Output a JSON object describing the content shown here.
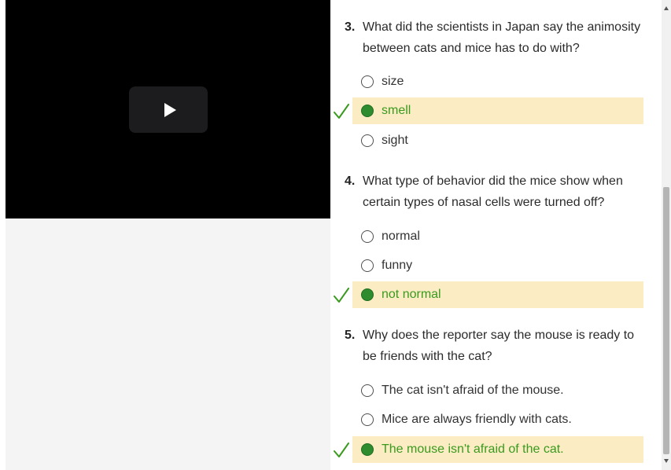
{
  "colors": {
    "accent_correct": "#3a9a1e",
    "correct_highlight": "#fbecc4",
    "radio_fill": "#2e8b2e",
    "video_bg": "#000000"
  },
  "video": {
    "play_icon": "play-icon"
  },
  "questions": [
    {
      "number": "3.",
      "text": "What did the scientists in Japan say the animosity between cats and mice has to do with?",
      "options": [
        {
          "label": "size",
          "selected": false,
          "correct": false
        },
        {
          "label": "smell",
          "selected": true,
          "correct": true
        },
        {
          "label": "sight",
          "selected": false,
          "correct": false
        }
      ]
    },
    {
      "number": "4.",
      "text": "What type of behavior did the mice show when certain types of nasal cells were turned off?",
      "options": [
        {
          "label": "normal",
          "selected": false,
          "correct": false
        },
        {
          "label": "funny",
          "selected": false,
          "correct": false
        },
        {
          "label": "not normal",
          "selected": true,
          "correct": true
        }
      ]
    },
    {
      "number": "5.",
      "text": "Why does the reporter say the mouse is ready to be friends with the cat?",
      "options": [
        {
          "label": "The cat isn't afraid of the mouse.",
          "selected": false,
          "correct": false
        },
        {
          "label": "Mice are always friendly with cats.",
          "selected": false,
          "correct": false
        },
        {
          "label": "The mouse isn't afraid of the cat.",
          "selected": true,
          "correct": true
        }
      ]
    }
  ]
}
